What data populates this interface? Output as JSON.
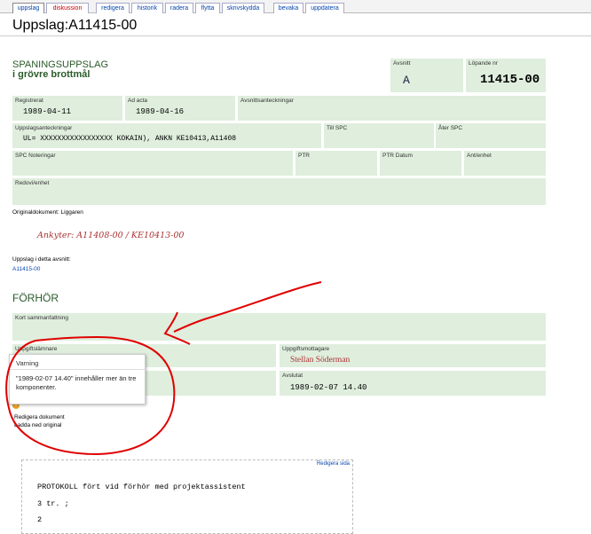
{
  "tabs": [
    {
      "label": "uppslag",
      "selected": true
    },
    {
      "label": "diskussion",
      "red": true
    },
    {
      "label": "redigera"
    },
    {
      "label": "historik"
    },
    {
      "label": "radera"
    },
    {
      "label": "flytta"
    },
    {
      "label": "skrivskydda"
    },
    {
      "label": "bevaka"
    },
    {
      "label": "uppdatera"
    }
  ],
  "page": {
    "title": "Uppslag:A11415-00"
  },
  "header": {
    "title_line1": "SPANINGSUPPSLAG",
    "title_line2": "i grövre brottmål",
    "avsnitt_label": "Avsnitt",
    "avsnitt_value": "A",
    "lopande_label": "Löpande nr",
    "lopande_value": "11415-00"
  },
  "fields": {
    "registrerat_label": "Registrerat",
    "registrerat_value": "1989-04-11",
    "ad_acta_label": "Ad acta",
    "ad_acta_value": "1989-04-16",
    "avsnittsanteckningar_label": "Avsnittsanteckningar",
    "uppslagsanteckningar_label": "Uppslagsanteckningar",
    "uppslagsanteckningar_value": "UL= XXXXXXXXXXXXXXXXX KOKAIN), ANKN KE10413,A11408",
    "till_spc_label": "Till SPC",
    "ater_spc_label": "Åter SPC",
    "spc_noteringar_label": "SPC Noteringar",
    "ptr_label": "PTR",
    "ptr_datum_label": "PTR Datum",
    "ant_enhet_label": "Ant/enhet",
    "redovifenhet_label": "Redovi/enhet",
    "originaldokument": "Originaldokument: Liggaren"
  },
  "handwritten_note": "Ankyter: A11408-00 / KE10413-00",
  "uppslag_i_avsnitt": {
    "label": "Uppslag i detta avsnitt:",
    "value": "A11415-00"
  },
  "forhor": {
    "heading": "FÖRHÖR",
    "kort_label": "Kort sammanfattning",
    "uppgiftslamnare_label": "Uppgiftslämnare",
    "uppgiftsmottagare_label": "Uppgiftsmottagare",
    "uppgiftsmottagare_value": "Stellan Söderman",
    "avslutat_label": "Avslutat",
    "avslutat_value": "1989-02-07 14.40"
  },
  "warning": {
    "title": "Varning",
    "text": "\"1989-02-07 14.40\" innehåller mer än tre komponenter.",
    "icon_glyph": "!"
  },
  "redigera_dokument": "Redigera dokument",
  "ladda_ned": "Ladda ned original",
  "document": {
    "edit_link": "Redigera sida",
    "line1": "PROTOKOLL fört vid förhör med projektassistent",
    "line2": "3 tr. ;",
    "line3": "2"
  },
  "colors": {
    "field_bg": "#dfeedd",
    "link": "#0645ad",
    "annotation_red": "#e00000",
    "handwriting": "#a33"
  }
}
